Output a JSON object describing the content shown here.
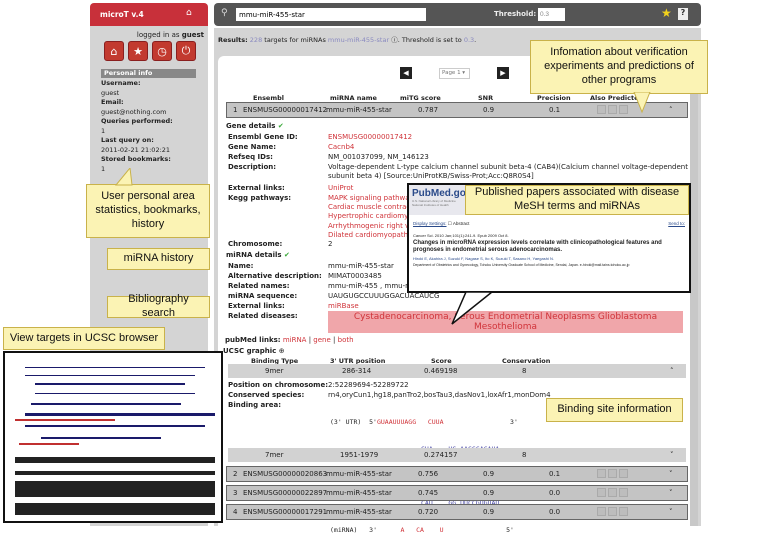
{
  "app": {
    "title": "microT v.4",
    "home_icon": "home-icon"
  },
  "user": {
    "logged_in_prefix": "logged in as ",
    "username_bold": "guest",
    "icons": [
      "house-icon",
      "star-icon",
      "clock-icon",
      "power-icon"
    ],
    "personal_info_title": "Personal info",
    "fields": [
      {
        "label": "Username:",
        "value": "guest"
      },
      {
        "label": "Email:",
        "value": "guest@nothing.com"
      },
      {
        "label": "Queries performed:",
        "value": "1"
      },
      {
        "label": "Last query on:",
        "value": "2011-02-21 21:02:21"
      },
      {
        "label": "Stored bookmarks:",
        "value": "1"
      }
    ]
  },
  "search": {
    "value": "mmu-miR-455-star",
    "threshold_label": "Threshold:",
    "threshold_value": "0.3"
  },
  "results": {
    "prefix": "Results:",
    "count": "228",
    "mid": " targets for miRNAs ",
    "mirna": "mmu-miR-455-star",
    "suffix": ". Threshold is set to ",
    "threshold": "0.3",
    "end": "."
  },
  "pager": {
    "page": "Page 1"
  },
  "table": {
    "headers": [
      "Ensembl Gene Id",
      "miRNA name",
      "miTG score",
      "SNR",
      "Precision",
      "Also Predicted"
    ],
    "rows": [
      {
        "rank": "1",
        "gene": "ENSMUSG00000017412",
        "mirna": "mmu-miR-455-star",
        "score": "0.787",
        "snr": "0.9",
        "precision": "0.1"
      },
      {
        "rank": "2",
        "gene": "ENSMUSG00000020863",
        "mirna": "mmu-miR-455-star",
        "score": "0.756",
        "snr": "0.9",
        "precision": "0.1"
      },
      {
        "rank": "3",
        "gene": "ENSMUSG00000022897",
        "mirna": "mmu-miR-455-star",
        "score": "0.745",
        "snr": "0.9",
        "precision": "0.0"
      },
      {
        "rank": "4",
        "gene": "ENSMUSG00000017291",
        "mirna": "mmu-miR-455-star",
        "score": "0.720",
        "snr": "0.9",
        "precision": "0.0"
      }
    ]
  },
  "gene_details": {
    "title": "Gene details",
    "ensembl_label": "Ensembl Gene ID:",
    "ensembl": "ENSMUSG00000017412",
    "name_label": "Gene Name:",
    "name": "Cacnb4",
    "refseq_label": "Refseq IDs:",
    "refseq": "NM_001037099, NM_146123",
    "desc_label": "Description:",
    "desc": "Voltage-dependent L-type calcium channel subunit beta-4 (CAB4)(Calcium channel voltage-dependent subunit beta 4) [Source:UniProtKB/Swiss-Prot;Acc:Q8R0S4]",
    "ext_label": "External links:",
    "ext": "UniProt",
    "kegg_label": "Kegg pathways:",
    "kegg": [
      "MAPK signaling pathway",
      "Cardiac muscle contraction",
      "Hypertrophic cardiomyopathy",
      "Arrhythmogenic right ventricular",
      "Dilated cardiomyopathy"
    ],
    "chrom_label": "Chromosome:",
    "chrom": "2"
  },
  "mirna_details": {
    "title": "miRNA details",
    "name_label": "Name:",
    "name": "mmu-miR-455-star",
    "alt_label": "Alternative description:",
    "alt": "MIMAT0003485",
    "related_label": "Related names:",
    "related": "mmu-miR-455 , mmu-miR-455-5p",
    "seq_label": "miRNA sequence:",
    "seq": "UAUGUGCCUUUGGACUACAUCG",
    "ext_label": "External links:",
    "ext": "miRBase",
    "dis_label": "Related diseases:",
    "diseases": "Cystadenocarcinoma, Serous Endometrial Neoplasms Glioblastoma Mesothelioma"
  },
  "pubmed_links": {
    "label": "pubMed links:",
    "miRNA": "miRNA",
    "gene": "gene",
    "both": "both",
    "sep": "|"
  },
  "ucsc": {
    "label": "UCSC graphic"
  },
  "binding": {
    "headers": [
      "Binding Type",
      "3' UTR position",
      "Score",
      "Conservation"
    ],
    "sites": [
      {
        "type": "9mer",
        "pos": "286-314",
        "score": "0.469198",
        "cons": "8"
      },
      {
        "type": "7mer",
        "pos": "1951-1979",
        "score": "0.274157",
        "cons": "8"
      }
    ],
    "chrom_pos_label": "Position on chromosome:",
    "chrom_pos": "2:52289694-52289722",
    "species_label": "Conserved species:",
    "species": "rn4,oryCun1,hg18,panTro2,bosTau3,dasNov1,loxAfr1,monDom4",
    "area_label": "Binding area:",
    "utr_line": {
      "tag": "(3' UTR)",
      "five": "5'",
      "seq": "GUAAUUUAGG   CUUA",
      "three": "3'"
    },
    "line2": "GUA    UC AAGGCACAUA",
    "line3": "|||    -| ||||||||||",
    "line4": "CAU    GG UUCCGUGUAU",
    "mirna_line": {
      "tag": "(miRNA)",
      "three": "3'",
      "seq": "A   CA    U",
      "five": "5'"
    }
  },
  "pubmed_popup": {
    "logo": "PubMed.gov",
    "logo_sub1": "U.S. National Library of Medicine",
    "logo_sub2": "National Institutes of Health",
    "display": "Display Settings:",
    "abstract": "Abstract",
    "send": "Send to:",
    "citation": "Cancer Sci. 2010 Jan;101(1):241-9. Epub 2009 Oct 8.",
    "title": "Changes in microRNA expression levels correlate with clinicopathological features and prognoses in endometrial serous adenocarcinomas.",
    "authors": "Hiroki E, Akahira J, Suzuki F, Nagase S, Ito K, Suzuki T, Sasano H, Yaegashi N.",
    "affiliation": "Department of Obstetrics and Gynecology, Tohoku University Graduate School of Medicine, Sendai, Japan. e-hiroki@mail.tains.tohoku.ac.jp"
  },
  "callouts": {
    "verification": "Infomation about verification experiments and predictions of other programs",
    "personal": "User personal area statistics, bookmarks, history",
    "history": "miRNA history",
    "biblio": "Bibliography search",
    "ucsc": "View targets in UCSC browser",
    "pubmed": "Published papers associated with disease MeSH terms and miRNAs",
    "binding": "Binding site information"
  },
  "colors": {
    "brand_red": "#c8303a",
    "link_red": "#d0343a",
    "callout": "#fbf3b4",
    "disease_bg": "#f0a6aa"
  }
}
